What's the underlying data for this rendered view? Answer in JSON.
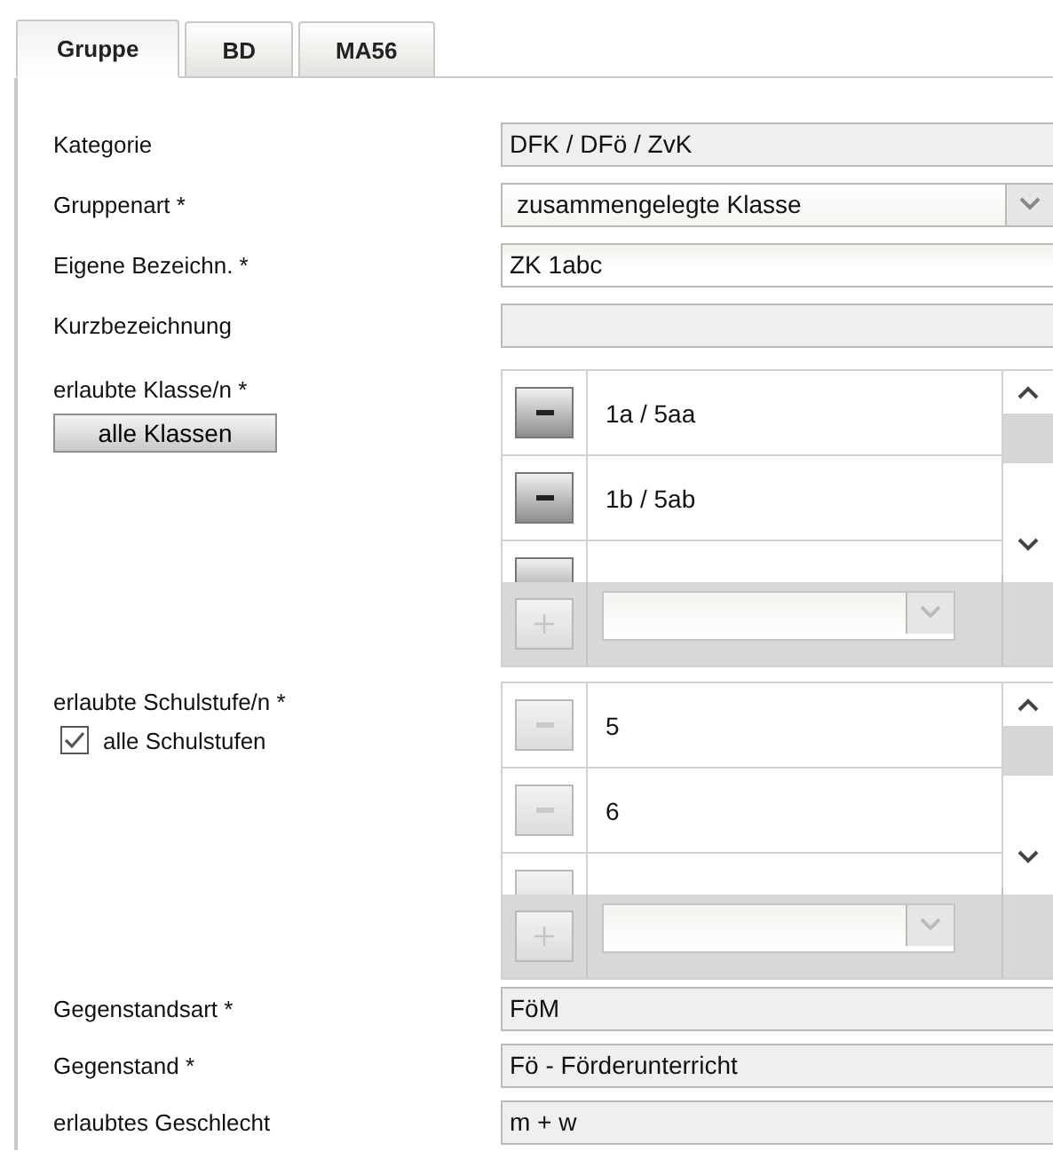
{
  "tabs": [
    {
      "label": "Gruppe",
      "selected": true
    },
    {
      "label": "BD",
      "selected": false
    },
    {
      "label": "MA56",
      "selected": false
    }
  ],
  "fields_top": [
    {
      "kind": "readonly",
      "label": "Kategorie",
      "value": "DFK / DFö / ZvK"
    },
    {
      "kind": "select",
      "label": "Gruppenart *",
      "value": "zusammengelegte Klasse"
    },
    {
      "kind": "text",
      "label": "Eigene Bezeichn. *",
      "value": "ZK 1abc"
    },
    {
      "kind": "readonly",
      "label": "Kurzbezeichnung"
    }
  ],
  "lists": [
    {
      "label": "erlaubte Klasse/n *",
      "control": {
        "kind": "button",
        "label": "alle Klassen"
      },
      "remove_disabled": false,
      "items": [
        "1a / 5aa",
        "1b / 5ab"
      ]
    },
    {
      "label": "erlaubte Schulstufe/n *",
      "control": {
        "kind": "checkbox",
        "label": "alle Schulstufen",
        "checked": true
      },
      "remove_disabled": true,
      "items": [
        "5",
        "6"
      ]
    }
  ],
  "fields_bottom": [
    {
      "kind": "readonly",
      "label": "Gegenstandsart *",
      "value": "FöM"
    },
    {
      "kind": "readonly",
      "label": "Gegenstand *",
      "value": "Fö - Förderunterricht"
    },
    {
      "kind": "readonly",
      "label": "erlaubtes Geschlecht",
      "value": "m + w"
    }
  ]
}
